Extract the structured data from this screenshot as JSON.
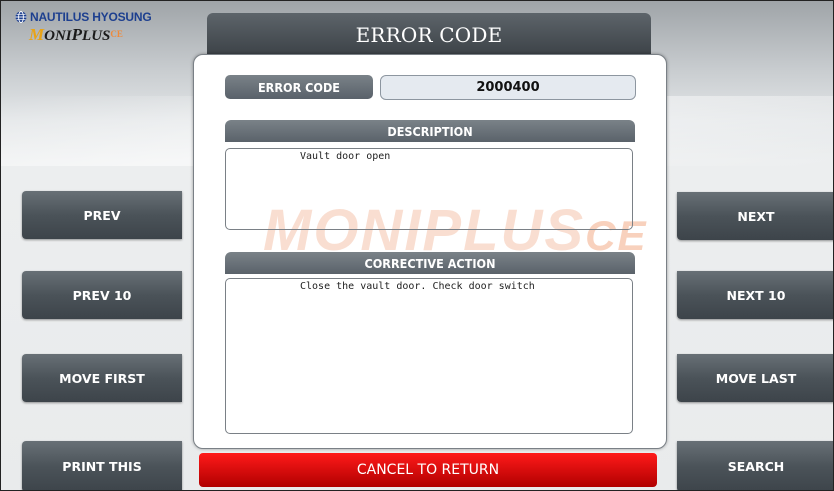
{
  "logo": {
    "brand": "NAUTILUS HYOSUNG",
    "product_main": "ONI",
    "product_m": "M",
    "product_p": "P",
    "product_rest": "LUS",
    "product_suffix": "CE"
  },
  "header": {
    "title": "ERROR CODE"
  },
  "error": {
    "label": "ERROR CODE",
    "value": "2000400"
  },
  "description": {
    "heading": "DESCRIPTION",
    "text": "Vault door open"
  },
  "corrective": {
    "heading": "CORRECTIVE ACTION",
    "text": "Close the vault door. Check door switch"
  },
  "watermark": {
    "text": "MONIPLUS",
    "suffix": "CE"
  },
  "left_buttons": [
    "PREV",
    "PREV 10",
    "MOVE FIRST",
    "PRINT THIS"
  ],
  "right_buttons": [
    "NEXT",
    "NEXT 10",
    "MOVE LAST",
    "SEARCH"
  ],
  "cancel_label": "CANCEL TO RETURN",
  "colors": {
    "header_bg": "#4a5157",
    "button_bg": "#4b5359",
    "cancel_bg": "#d90000",
    "brand_blue": "#1d3f8f",
    "brand_orange": "#e8a317"
  }
}
